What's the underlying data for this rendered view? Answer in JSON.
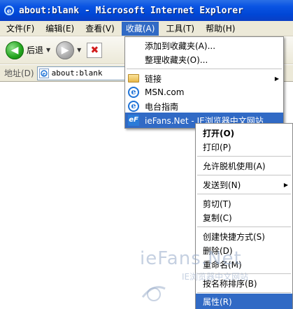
{
  "window": {
    "title": "about:blank - Microsoft Internet Explorer"
  },
  "menubar": {
    "items": [
      {
        "label": "文件(F)"
      },
      {
        "label": "编辑(E)"
      },
      {
        "label": "查看(V)"
      },
      {
        "label": "收藏(A)"
      },
      {
        "label": "工具(T)"
      },
      {
        "label": "帮助(H)"
      }
    ]
  },
  "toolbar": {
    "back_label": "后退"
  },
  "addressbar": {
    "label": "地址(D)",
    "value": "about:blank"
  },
  "favorites_menu": {
    "items": [
      {
        "label": "添加到收藏夹(A)..."
      },
      {
        "label": "整理收藏夹(O)..."
      },
      {
        "label": "链接"
      },
      {
        "label": "MSN.com"
      },
      {
        "label": "电台指南"
      },
      {
        "label": "ieFans.Net - IE浏览器中文网站"
      }
    ]
  },
  "context_menu": {
    "items": [
      {
        "label": "打开(O)"
      },
      {
        "label": "打印(P)"
      },
      {
        "label": "允许脱机使用(A)"
      },
      {
        "label": "发送到(N)"
      },
      {
        "label": "剪切(T)"
      },
      {
        "label": "复制(C)"
      },
      {
        "label": "创建快捷方式(S)"
      },
      {
        "label": "删除(D)"
      },
      {
        "label": "重命名(M)"
      },
      {
        "label": "按名称排序(B)"
      },
      {
        "label": "属性(R)"
      }
    ]
  },
  "watermark": {
    "line1": "ieFans.Net",
    "line2": "IE浏览器中文网站"
  },
  "colors": {
    "titlebar": "#0a54e3",
    "highlight": "#316ac5",
    "menubar": "#ece9d8"
  }
}
